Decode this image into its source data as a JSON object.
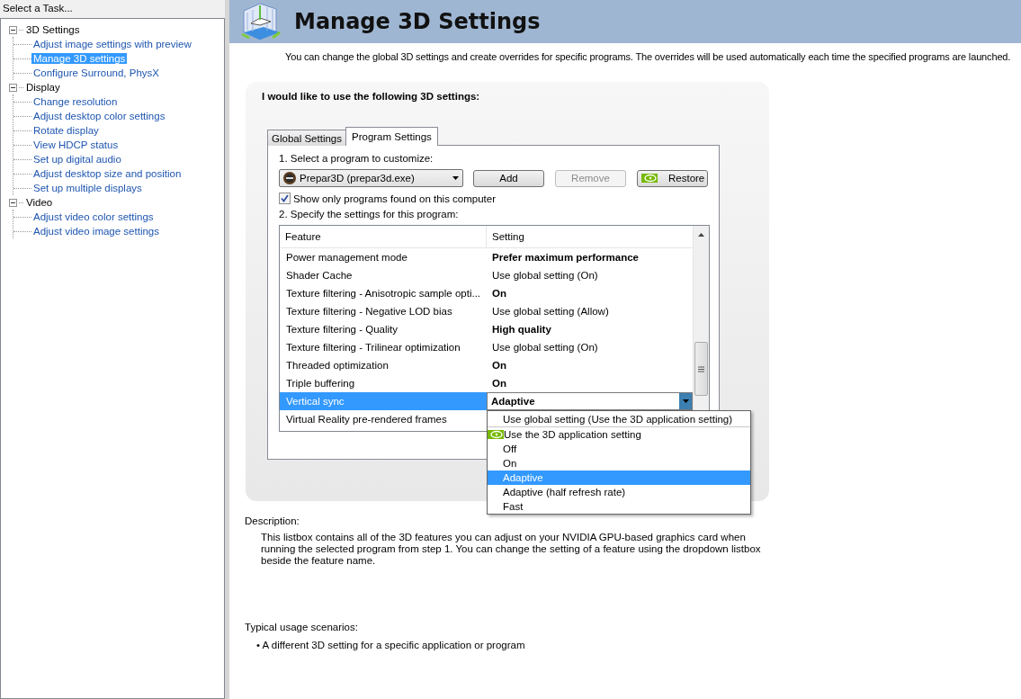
{
  "sidebar": {
    "title": "Select a Task...",
    "tree": [
      {
        "label": "3D Settings",
        "expanded": true,
        "selected": false,
        "children": [
          {
            "label": "Adjust image settings with preview",
            "selected": false
          },
          {
            "label": "Manage 3D settings",
            "selected": true
          },
          {
            "label": "Configure Surround, PhysX",
            "selected": false
          }
        ]
      },
      {
        "label": "Display",
        "expanded": true,
        "selected": false,
        "children": [
          {
            "label": "Change resolution",
            "selected": false
          },
          {
            "label": "Adjust desktop color settings",
            "selected": false
          },
          {
            "label": "Rotate display",
            "selected": false
          },
          {
            "label": "View HDCP status",
            "selected": false
          },
          {
            "label": "Set up digital audio",
            "selected": false
          },
          {
            "label": "Adjust desktop size and position",
            "selected": false
          },
          {
            "label": "Set up multiple displays",
            "selected": false
          }
        ]
      },
      {
        "label": "Video",
        "expanded": true,
        "selected": false,
        "children": [
          {
            "label": "Adjust video color settings",
            "selected": false
          },
          {
            "label": "Adjust video image settings",
            "selected": false
          }
        ]
      }
    ]
  },
  "header": {
    "title": "Manage 3D Settings"
  },
  "intro": "You can change the global 3D settings and create overrides for specific programs. The overrides will be used automatically each time the specified programs are launched.",
  "panel": {
    "heading": "I would like to use the following 3D settings:",
    "tabs": [
      {
        "label": "Global Settings",
        "selected": false
      },
      {
        "label": "Program Settings",
        "selected": true
      }
    ],
    "step1": "1. Select a program to customize:",
    "program": "Prepar3D (prepar3d.exe)",
    "buttons": [
      {
        "label": "Add",
        "disabled": false,
        "kind": "plain"
      },
      {
        "label": "Remove",
        "disabled": true,
        "kind": "plain"
      },
      {
        "label": "Restore",
        "disabled": false,
        "kind": "logo"
      }
    ],
    "show_only": {
      "label": "Show only programs found on this computer",
      "checked": true
    },
    "step2": "2. Specify the settings for this program:",
    "columns": [
      "Feature",
      "Setting"
    ],
    "rows": [
      {
        "feature": "Power management mode",
        "setting": "Prefer maximum performance",
        "overridden": true,
        "selected": false
      },
      {
        "feature": "Shader Cache",
        "setting": "Use global setting (On)",
        "overridden": false,
        "selected": false
      },
      {
        "feature": "Texture filtering - Anisotropic sample opti...",
        "setting": "On",
        "overridden": true,
        "selected": false
      },
      {
        "feature": "Texture filtering - Negative LOD bias",
        "setting": "Use global setting (Allow)",
        "overridden": false,
        "selected": false
      },
      {
        "feature": "Texture filtering - Quality",
        "setting": "High quality",
        "overridden": true,
        "selected": false
      },
      {
        "feature": "Texture filtering - Trilinear optimization",
        "setting": "Use global setting (On)",
        "overridden": false,
        "selected": false
      },
      {
        "feature": "Threaded optimization",
        "setting": "On",
        "overridden": true,
        "selected": false
      },
      {
        "feature": "Triple buffering",
        "setting": "On",
        "overridden": true,
        "selected": false
      },
      {
        "feature": "Vertical sync",
        "setting": "Adaptive",
        "overridden": true,
        "selected": true
      },
      {
        "feature": "Virtual Reality pre-rendered frames",
        "overridden": false,
        "selected": false
      }
    ],
    "dropdown": [
      {
        "label": "Use global setting (Use the 3D application setting)",
        "kind": "global",
        "selected": false
      },
      {
        "label": "Use the 3D application setting",
        "kind": "recommended",
        "selected": false
      },
      {
        "label": "Off",
        "kind": "option",
        "selected": false
      },
      {
        "label": "On",
        "kind": "option",
        "selected": false
      },
      {
        "label": "Adaptive",
        "kind": "option",
        "selected": true
      },
      {
        "label": "Adaptive (half refresh rate)",
        "kind": "option",
        "selected": false
      },
      {
        "label": "Fast",
        "kind": "option",
        "selected": false
      }
    ]
  },
  "description": {
    "label": "Description:",
    "text": "This listbox contains all of the 3D features you can adjust on your NVIDIA GPU-based graphics card when running the selected program from step 1. You can change the setting of a feature using the dropdown listbox beside the feature name."
  },
  "usage": {
    "label": "Typical usage scenarios:",
    "items": [
      "• A different 3D setting for a specific application or program"
    ]
  }
}
